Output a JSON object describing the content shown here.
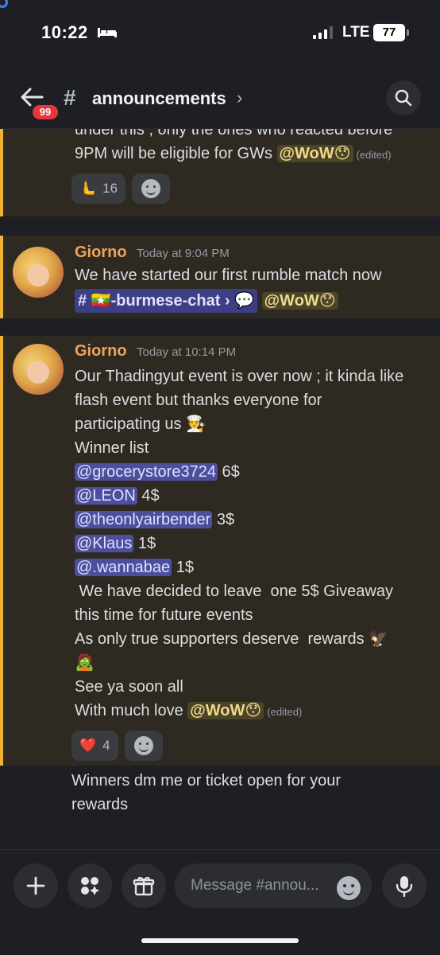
{
  "status_bar": {
    "time": "10:22",
    "network": "LTE",
    "battery": "77"
  },
  "header": {
    "unread_badge": "99",
    "channel_name": "announcements",
    "chevron": "›"
  },
  "messages": [
    {
      "lines": [
        "under this ; only the ones who reacted before",
        "9PM  will be eligible for GWs"
      ],
      "mention": "@WoW",
      "edited": "(edited)",
      "reactions": [
        {
          "emoji": "🫷",
          "count": "16"
        }
      ]
    },
    {
      "author": "Giorno",
      "timestamp": "Today at 9:04 PM",
      "line": "We have started our first rumble match now",
      "channel_hash": "#",
      "channel_flag": "🇲🇲",
      "channel_label": "-burmese-chat",
      "channel_chev": "›",
      "mention": "@WoW"
    },
    {
      "author": "Giorno",
      "timestamp": "Today at 10:14 PM",
      "lines_intro": [
        "Our Thadingyut event is over now ; it kinda like",
        "flash event but thanks everyone for",
        "participating us"
      ],
      "intro_emoji": "🧑‍🍳",
      "winner_heading": "Winner list",
      "winners": [
        {
          "name": "@grocerystore3724",
          "prize": "6$"
        },
        {
          "name": "@LEON",
          "prize": "4$"
        },
        {
          "name": "@theonlyairbender",
          "prize": "3$"
        },
        {
          "name": "@Klaus",
          "prize": "1$"
        },
        {
          "name": "@.wannabae",
          "prize": "1$"
        }
      ],
      "lines_outro": [
        " We have decided to leave  one 5$ Giveaway",
        "this time for future events",
        "As only true supporters deserve  rewards"
      ],
      "rewards_emoji": "🦅",
      "hulk_emoji": "🧟",
      "see_ya": "See ya soon all",
      "love_prefix": "With much love",
      "mention": "@WoW",
      "edited": "(edited)",
      "reactions": [
        {
          "emoji": "❤️",
          "count": "4"
        }
      ]
    },
    {
      "lines": [
        "Winners dm me or ticket open for your",
        "rewards"
      ]
    }
  ],
  "composer": {
    "placeholder": "Message #annou..."
  },
  "icons": {
    "wow_emoji": "😯",
    "channel_emoji": "💬"
  }
}
